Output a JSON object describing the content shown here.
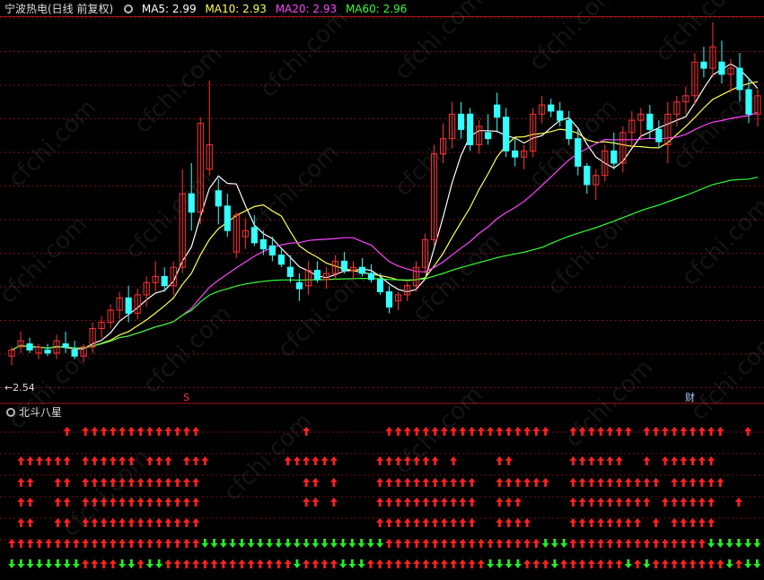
{
  "header": {
    "stock_title": "宁波热电(日线 前复权)",
    "ma_labels": [
      {
        "label": "MA5: 2.99",
        "color": "#ffffff"
      },
      {
        "label": "MA10: 2.93",
        "color": "#ffff55"
      },
      {
        "label": "MA20: 2.93",
        "color": "#ff44ff"
      },
      {
        "label": "MA60: 2.96",
        "color": "#33ff33"
      }
    ]
  },
  "price_pane": {
    "low_marker": "←2.54",
    "event_markers": [
      {
        "label": "S",
        "color": "#ff3333"
      },
      {
        "label": "财",
        "color": "#aaccff"
      }
    ],
    "watermark": "cfchi.com"
  },
  "indicator_pane": {
    "title": "北斗八星"
  },
  "colors": {
    "up": "#ff3333",
    "down": "#33ffff",
    "grid": "#7a1010",
    "ma5": "#ffffff",
    "ma10": "#ffff55",
    "ma20": "#ff44ff",
    "ma60": "#33ff33",
    "arrow_up": "#ff2020",
    "arrow_down": "#22ee22"
  },
  "chart_data": {
    "type": "candlestick",
    "ylim": [
      2.5,
      3.7
    ],
    "candles": [
      {
        "o": 2.59,
        "h": 2.62,
        "l": 2.56,
        "c": 2.61
      },
      {
        "o": 2.62,
        "h": 2.67,
        "l": 2.6,
        "c": 2.64
      },
      {
        "o": 2.63,
        "h": 2.65,
        "l": 2.6,
        "c": 2.61
      },
      {
        "o": 2.6,
        "h": 2.63,
        "l": 2.58,
        "c": 2.62
      },
      {
        "o": 2.61,
        "h": 2.63,
        "l": 2.59,
        "c": 2.6
      },
      {
        "o": 2.6,
        "h": 2.66,
        "l": 2.58,
        "c": 2.64
      },
      {
        "o": 2.63,
        "h": 2.67,
        "l": 2.6,
        "c": 2.62
      },
      {
        "o": 2.61,
        "h": 2.64,
        "l": 2.58,
        "c": 2.59
      },
      {
        "o": 2.59,
        "h": 2.63,
        "l": 2.57,
        "c": 2.62
      },
      {
        "o": 2.62,
        "h": 2.7,
        "l": 2.6,
        "c": 2.68
      },
      {
        "o": 2.68,
        "h": 2.72,
        "l": 2.65,
        "c": 2.7
      },
      {
        "o": 2.7,
        "h": 2.76,
        "l": 2.68,
        "c": 2.74
      },
      {
        "o": 2.74,
        "h": 2.8,
        "l": 2.71,
        "c": 2.78
      },
      {
        "o": 2.78,
        "h": 2.82,
        "l": 2.7,
        "c": 2.73
      },
      {
        "o": 2.73,
        "h": 2.81,
        "l": 2.71,
        "c": 2.79
      },
      {
        "o": 2.79,
        "h": 2.85,
        "l": 2.75,
        "c": 2.83
      },
      {
        "o": 2.83,
        "h": 2.9,
        "l": 2.8,
        "c": 2.85
      },
      {
        "o": 2.85,
        "h": 2.88,
        "l": 2.8,
        "c": 2.82
      },
      {
        "o": 2.82,
        "h": 2.9,
        "l": 2.79,
        "c": 2.88
      },
      {
        "o": 2.88,
        "h": 3.2,
        "l": 2.86,
        "c": 3.12
      },
      {
        "o": 3.12,
        "h": 3.22,
        "l": 3.0,
        "c": 3.06
      },
      {
        "o": 3.06,
        "h": 3.37,
        "l": 3.02,
        "c": 3.35
      },
      {
        "o": 3.2,
        "h": 3.49,
        "l": 3.18,
        "c": 3.28
      },
      {
        "o": 3.13,
        "h": 3.17,
        "l": 3.02,
        "c": 3.08
      },
      {
        "o": 3.08,
        "h": 3.12,
        "l": 2.98,
        "c": 3.0
      },
      {
        "o": 2.93,
        "h": 3.06,
        "l": 2.91,
        "c": 3.05
      },
      {
        "o": 2.98,
        "h": 3.04,
        "l": 2.94,
        "c": 3.0
      },
      {
        "o": 3.01,
        "h": 3.05,
        "l": 2.95,
        "c": 2.96
      },
      {
        "o": 2.97,
        "h": 3.0,
        "l": 2.92,
        "c": 2.94
      },
      {
        "o": 2.95,
        "h": 2.98,
        "l": 2.9,
        "c": 2.92
      },
      {
        "o": 2.92,
        "h": 2.94,
        "l": 2.88,
        "c": 2.89
      },
      {
        "o": 2.88,
        "h": 2.92,
        "l": 2.83,
        "c": 2.85
      },
      {
        "o": 2.83,
        "h": 2.86,
        "l": 2.77,
        "c": 2.81
      },
      {
        "o": 2.82,
        "h": 2.9,
        "l": 2.79,
        "c": 2.87
      },
      {
        "o": 2.87,
        "h": 2.9,
        "l": 2.83,
        "c": 2.84
      },
      {
        "o": 2.84,
        "h": 2.88,
        "l": 2.81,
        "c": 2.86
      },
      {
        "o": 2.86,
        "h": 2.92,
        "l": 2.84,
        "c": 2.9
      },
      {
        "o": 2.9,
        "h": 2.93,
        "l": 2.86,
        "c": 2.87
      },
      {
        "o": 2.87,
        "h": 2.9,
        "l": 2.84,
        "c": 2.88
      },
      {
        "o": 2.88,
        "h": 2.91,
        "l": 2.85,
        "c": 2.86
      },
      {
        "o": 2.86,
        "h": 2.89,
        "l": 2.83,
        "c": 2.84
      },
      {
        "o": 2.84,
        "h": 2.86,
        "l": 2.79,
        "c": 2.8
      },
      {
        "o": 2.8,
        "h": 2.82,
        "l": 2.73,
        "c": 2.75
      },
      {
        "o": 2.77,
        "h": 2.8,
        "l": 2.74,
        "c": 2.79
      },
      {
        "o": 2.79,
        "h": 2.83,
        "l": 2.77,
        "c": 2.82
      },
      {
        "o": 2.82,
        "h": 2.9,
        "l": 2.8,
        "c": 2.88
      },
      {
        "o": 2.88,
        "h": 2.99,
        "l": 2.86,
        "c": 2.97
      },
      {
        "o": 2.97,
        "h": 3.28,
        "l": 2.95,
        "c": 3.25
      },
      {
        "o": 3.25,
        "h": 3.35,
        "l": 3.22,
        "c": 3.3
      },
      {
        "o": 3.3,
        "h": 3.42,
        "l": 3.27,
        "c": 3.38
      },
      {
        "o": 3.38,
        "h": 3.42,
        "l": 3.3,
        "c": 3.33
      },
      {
        "o": 3.38,
        "h": 3.4,
        "l": 3.26,
        "c": 3.28
      },
      {
        "o": 3.28,
        "h": 3.36,
        "l": 3.25,
        "c": 3.34
      },
      {
        "o": 3.32,
        "h": 3.38,
        "l": 3.28,
        "c": 3.3
      },
      {
        "o": 3.41,
        "h": 3.45,
        "l": 3.32,
        "c": 3.37
      },
      {
        "o": 3.37,
        "h": 3.4,
        "l": 3.24,
        "c": 3.26
      },
      {
        "o": 3.26,
        "h": 3.3,
        "l": 3.21,
        "c": 3.24
      },
      {
        "o": 3.24,
        "h": 3.28,
        "l": 3.2,
        "c": 3.26
      },
      {
        "o": 3.26,
        "h": 3.4,
        "l": 3.24,
        "c": 3.38
      },
      {
        "o": 3.38,
        "h": 3.44,
        "l": 3.35,
        "c": 3.41
      },
      {
        "o": 3.41,
        "h": 3.43,
        "l": 3.37,
        "c": 3.39
      },
      {
        "o": 3.39,
        "h": 3.42,
        "l": 3.34,
        "c": 3.36
      },
      {
        "o": 3.36,
        "h": 3.39,
        "l": 3.28,
        "c": 3.3
      },
      {
        "o": 3.3,
        "h": 3.33,
        "l": 3.18,
        "c": 3.21
      },
      {
        "o": 3.21,
        "h": 3.22,
        "l": 3.12,
        "c": 3.15
      },
      {
        "o": 3.15,
        "h": 3.2,
        "l": 3.1,
        "c": 3.18
      },
      {
        "o": 3.18,
        "h": 3.28,
        "l": 3.16,
        "c": 3.26
      },
      {
        "o": 3.26,
        "h": 3.32,
        "l": 3.2,
        "c": 3.22
      },
      {
        "o": 3.22,
        "h": 3.34,
        "l": 3.19,
        "c": 3.32
      },
      {
        "o": 3.32,
        "h": 3.39,
        "l": 3.27,
        "c": 3.36
      },
      {
        "o": 3.36,
        "h": 3.4,
        "l": 3.3,
        "c": 3.38
      },
      {
        "o": 3.38,
        "h": 3.41,
        "l": 3.3,
        "c": 3.33
      },
      {
        "o": 3.33,
        "h": 3.36,
        "l": 3.27,
        "c": 3.29
      },
      {
        "o": 3.28,
        "h": 3.42,
        "l": 3.22,
        "c": 3.38
      },
      {
        "o": 3.38,
        "h": 3.44,
        "l": 3.34,
        "c": 3.42
      },
      {
        "o": 3.42,
        "h": 3.47,
        "l": 3.38,
        "c": 3.44
      },
      {
        "o": 3.44,
        "h": 3.58,
        "l": 3.41,
        "c": 3.55
      },
      {
        "o": 3.55,
        "h": 3.6,
        "l": 3.5,
        "c": 3.53
      },
      {
        "o": 3.53,
        "h": 3.68,
        "l": 3.5,
        "c": 3.6
      },
      {
        "o": 3.55,
        "h": 3.62,
        "l": 3.48,
        "c": 3.51
      },
      {
        "o": 3.51,
        "h": 3.56,
        "l": 3.45,
        "c": 3.53
      },
      {
        "o": 3.53,
        "h": 3.58,
        "l": 3.42,
        "c": 3.46
      },
      {
        "o": 3.46,
        "h": 3.5,
        "l": 3.35,
        "c": 3.38
      },
      {
        "o": 3.38,
        "h": 3.46,
        "l": 3.34,
        "c": 3.44
      }
    ]
  }
}
